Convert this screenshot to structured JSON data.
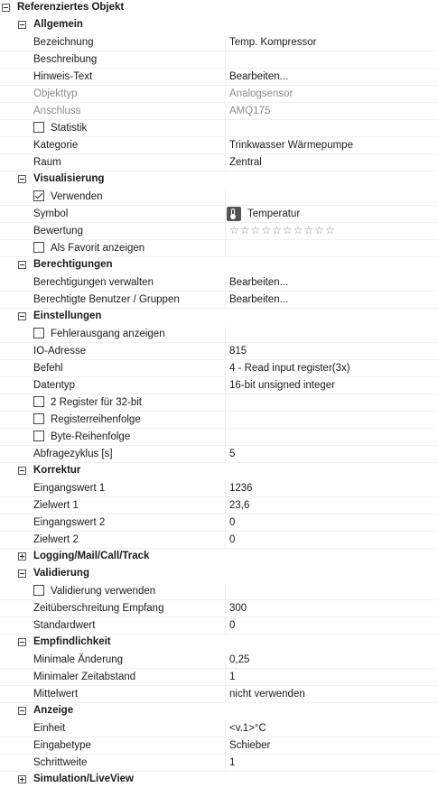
{
  "root": {
    "title": "Referenziertes Objekt"
  },
  "sections": [
    {
      "title": "Allgemein",
      "expanded": true,
      "items": [
        {
          "label": "Bezeichnung",
          "value": "Temp. Kompressor"
        },
        {
          "label": "Beschreibung",
          "value": ""
        },
        {
          "label": "Hinweis-Text",
          "value": "Bearbeiten..."
        },
        {
          "label": "Objekttyp",
          "value": "Analogsensor",
          "disabled": true
        },
        {
          "label": "Anschluss",
          "value": "AMQ175",
          "disabled": true
        },
        {
          "label": "Statistik",
          "checkbox": true,
          "checked": false
        },
        {
          "label": "Kategorie",
          "value": "Trinkwasser Wärmepumpe"
        },
        {
          "label": "Raum",
          "value": "Zentral"
        }
      ]
    },
    {
      "title": "Visualisierung",
      "expanded": true,
      "items": [
        {
          "label": "Verwenden",
          "checkbox": true,
          "checked": true
        },
        {
          "label": "Symbol",
          "value": "Temperatur",
          "icon": "thermometer-icon"
        },
        {
          "label": "Bewertung",
          "rating": 0,
          "rating_max": 10
        },
        {
          "label": "Als Favorit anzeigen",
          "checkbox": true,
          "checked": false
        }
      ]
    },
    {
      "title": "Berechtigungen",
      "expanded": true,
      "items": [
        {
          "label": "Berechtigungen verwalten",
          "value": "Bearbeiten..."
        },
        {
          "label": "Berechtigte Benutzer / Gruppen",
          "value": "Bearbeiten..."
        }
      ]
    },
    {
      "title": "Einstellungen",
      "expanded": true,
      "items": [
        {
          "label": "Fehlerausgang anzeigen",
          "checkbox": true,
          "checked": false
        },
        {
          "label": "IO-Adresse",
          "value": "815"
        },
        {
          "label": "Befehl",
          "value": "4 - Read input register(3x)"
        },
        {
          "label": "Datentyp",
          "value": "16-bit unsigned integer"
        },
        {
          "label": "2 Register für 32-bit",
          "checkbox": true,
          "checked": false
        },
        {
          "label": "Registerreihenfolge",
          "checkbox": true,
          "checked": false
        },
        {
          "label": "Byte-Reihenfolge",
          "checkbox": true,
          "checked": false
        },
        {
          "label": "Abfragezyklus [s]",
          "value": "5"
        }
      ]
    },
    {
      "title": "Korrektur",
      "expanded": true,
      "items": [
        {
          "label": "Eingangswert 1",
          "value": "1236"
        },
        {
          "label": "Zielwert 1",
          "value": "23,6"
        },
        {
          "label": "Eingangswert 2",
          "value": "0"
        },
        {
          "label": "Zielwert 2",
          "value": "0"
        }
      ]
    },
    {
      "title": "Logging/Mail/Call/Track",
      "expanded": false,
      "items": []
    },
    {
      "title": "Validierung",
      "expanded": true,
      "items": [
        {
          "label": "Validierung verwenden",
          "checkbox": true,
          "checked": false
        },
        {
          "label": "Zeitüberschreitung Empfang",
          "value": "300"
        },
        {
          "label": "Standardwert",
          "value": "0"
        }
      ]
    },
    {
      "title": "Empfindlichkeit",
      "expanded": true,
      "items": [
        {
          "label": "Minimale Änderung",
          "value": "0,25"
        },
        {
          "label": "Minimaler Zeitabstand",
          "value": "1"
        },
        {
          "label": "Mittelwert",
          "value": "nicht verwenden"
        }
      ]
    },
    {
      "title": "Anzeige",
      "expanded": true,
      "items": [
        {
          "label": "Einheit",
          "value": "<v.1>°C"
        },
        {
          "label": "Eingabetype",
          "value": "Schieber"
        },
        {
          "label": "Schrittweite",
          "value": "1"
        }
      ]
    },
    {
      "title": "Simulation/LiveView",
      "expanded": false,
      "items": []
    }
  ]
}
